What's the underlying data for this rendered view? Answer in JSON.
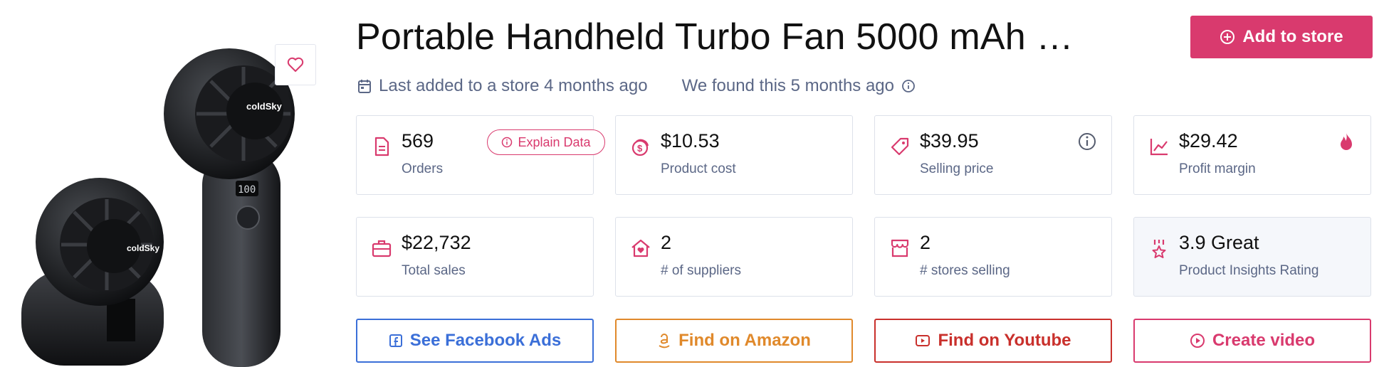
{
  "product": {
    "title": "Portable Handheld Turbo Fan 5000 mAh …",
    "brand_text": "coldSky",
    "display_text": "100"
  },
  "header": {
    "add_button": "Add to store",
    "last_added": "Last added to a store 4 months ago",
    "found": "We found this 5 months ago"
  },
  "explain_button": "Explain Data",
  "stats": [
    {
      "value": "569",
      "label": "Orders",
      "icon": "document-icon"
    },
    {
      "value": "$10.53",
      "label": "Product cost",
      "icon": "coins-icon"
    },
    {
      "value": "$39.95",
      "label": "Selling price",
      "icon": "tag-icon"
    },
    {
      "value": "$29.42",
      "label": "Profit margin",
      "icon": "chart-line-icon"
    },
    {
      "value": "$22,732",
      "label": "Total sales",
      "icon": "briefcase-icon"
    },
    {
      "value": "2",
      "label": "# of suppliers",
      "icon": "house-heart-icon"
    },
    {
      "value": "2",
      "label": "# stores selling",
      "icon": "store-icon"
    },
    {
      "value": "3.9 Great",
      "label": "Product Insights Rating",
      "icon": "award-icon"
    }
  ],
  "actions": [
    {
      "label": "See Facebook Ads",
      "color": "#3b6fd8",
      "icon": "facebook-icon"
    },
    {
      "label": "Find on Amazon",
      "color": "#e0892b",
      "icon": "amazon-icon"
    },
    {
      "label": "Find on Youtube",
      "color": "#c9302c",
      "icon": "youtube-icon"
    },
    {
      "label": "Create video",
      "color": "#d93a6e",
      "icon": "play-circle-icon"
    }
  ],
  "colors": {
    "accent": "#d93a6e",
    "muted_text": "#5b6786",
    "border": "#dde1ea"
  }
}
